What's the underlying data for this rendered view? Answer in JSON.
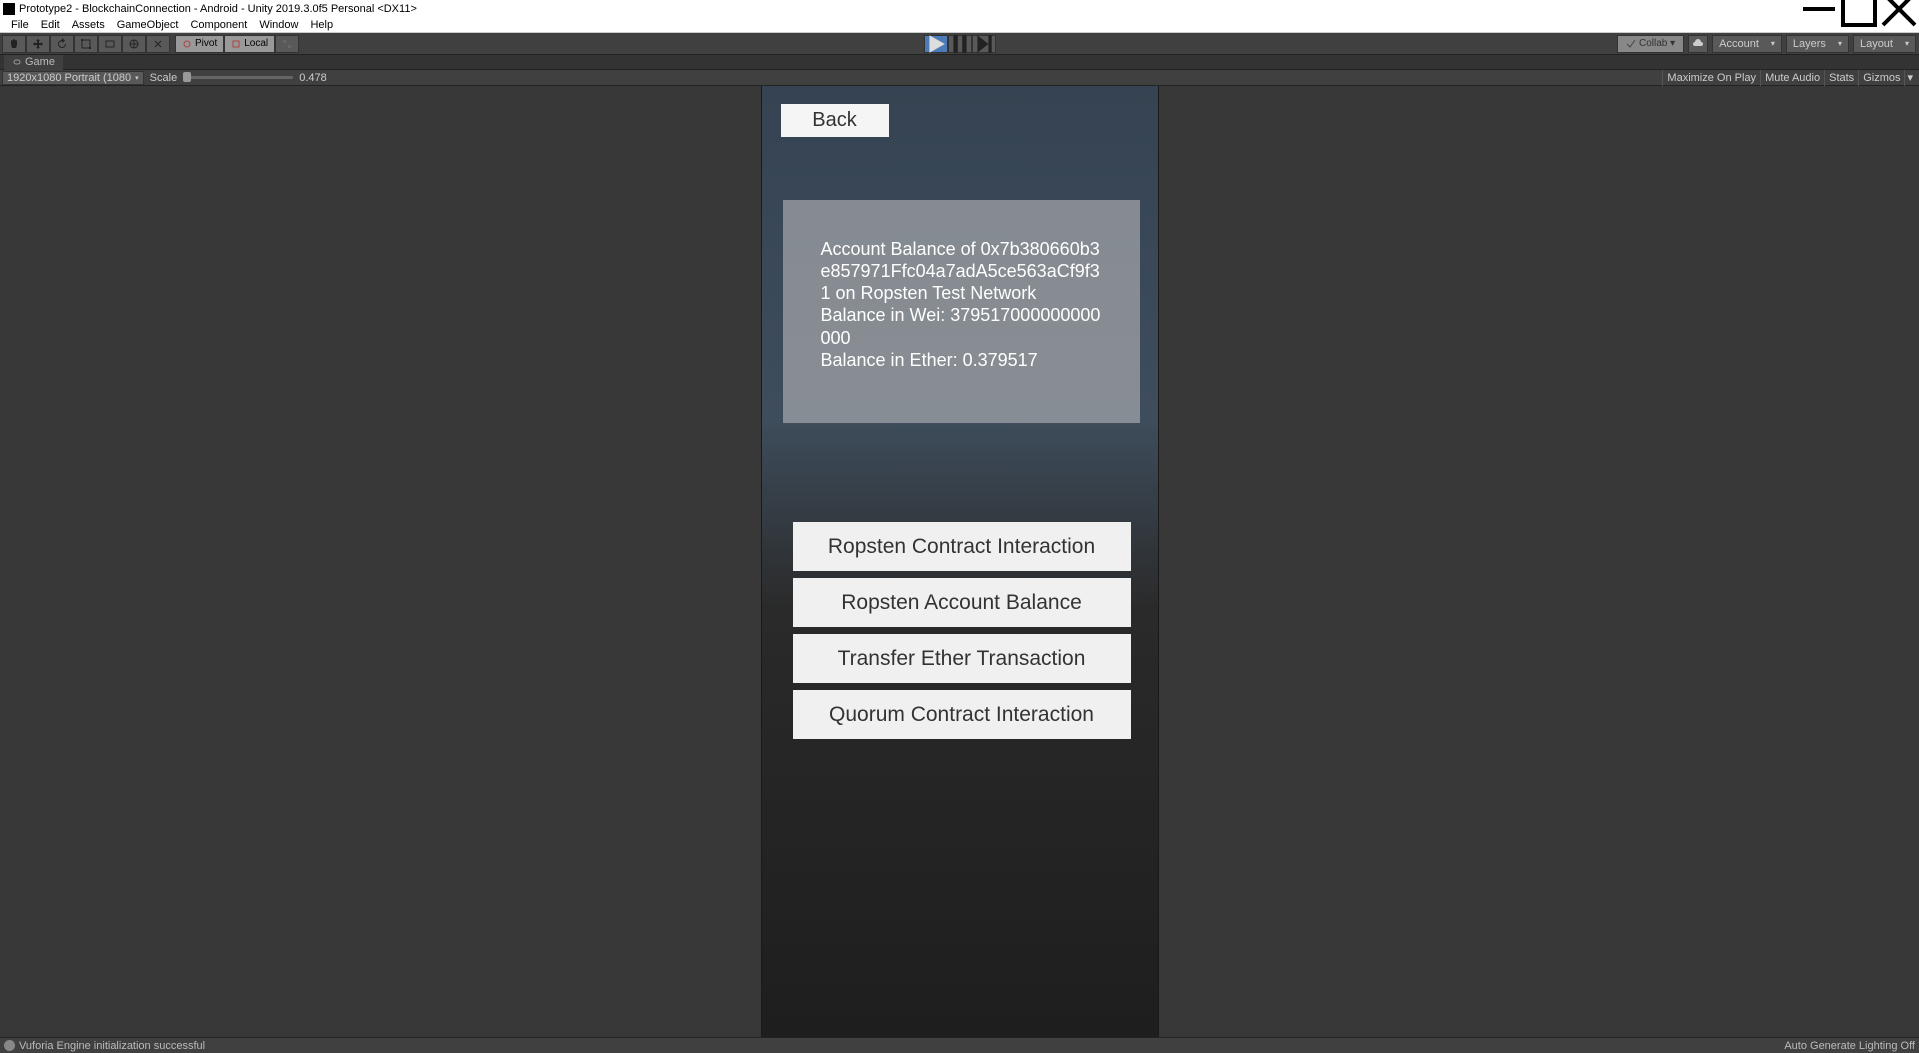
{
  "window": {
    "title": "Prototype2 - BlockchainConnection - Android - Unity 2019.3.0f5 Personal <DX11>"
  },
  "menu": {
    "file": "File",
    "edit": "Edit",
    "assets": "Assets",
    "gameobject": "GameObject",
    "component": "Component",
    "window": "Window",
    "help": "Help"
  },
  "toolbar": {
    "pivot": "Pivot",
    "local": "Local",
    "collab": "Collab",
    "account": "Account",
    "layers": "Layers",
    "layout": "Layout"
  },
  "tabs": {
    "game": "Game"
  },
  "game_controls": {
    "aspect": "1920x1080 Portrait (1080",
    "scale_label": "Scale",
    "scale_value": "0.478",
    "max_on_play": "Maximize On Play",
    "mute": "Mute Audio",
    "stats": "Stats",
    "gizmos": "Gizmos"
  },
  "app": {
    "back_label": "Back",
    "info_text": "Account Balance of 0x7b380660b3e857971Ffc04a7adA5ce563aCf9f31 on Ropsten Test Network\nBalance in Wei: 379517000000000000\nBalance in Ether: 0.379517",
    "buttons": [
      "Ropsten Contract Interaction",
      "Ropsten Account Balance",
      "Transfer Ether Transaction",
      "Quorum Contract Interaction"
    ]
  },
  "status": {
    "message": "Vuforia Engine initialization successful",
    "lighting": "Auto Generate Lighting Off"
  }
}
